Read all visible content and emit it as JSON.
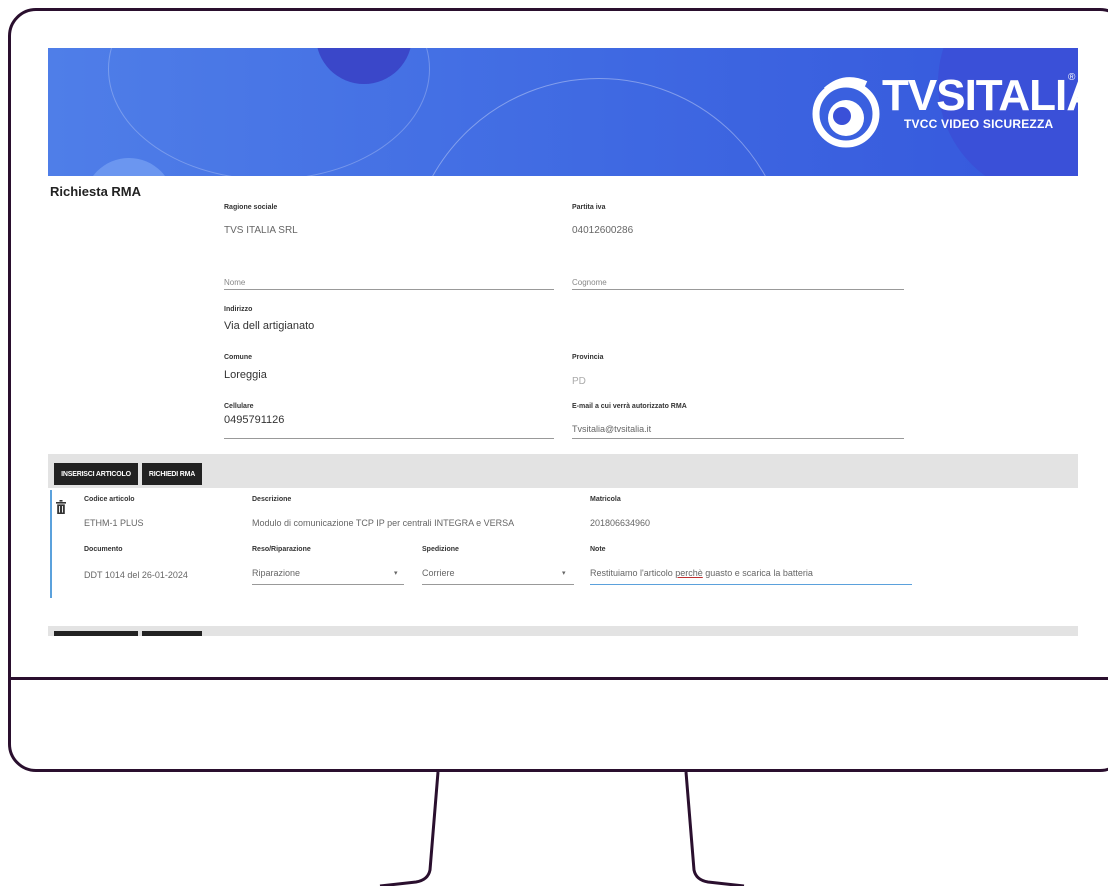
{
  "brand": {
    "name": "TVSITALIA",
    "registered": "®",
    "tagline": "TVCC VIDEO SICUREZZA"
  },
  "page_title": "Richiesta RMA",
  "form": {
    "ragione_sociale": {
      "label": "Ragione sociale",
      "value": "TVS ITALIA SRL"
    },
    "partita_iva": {
      "label": "Partita iva",
      "value": "04012600286"
    },
    "nome": {
      "placeholder": "Nome"
    },
    "cognome": {
      "placeholder": "Cognome"
    },
    "indirizzo": {
      "label": "Indirizzo",
      "value": "Via dell artigianato"
    },
    "comune": {
      "label": "Comune",
      "value": "Loreggia"
    },
    "provincia": {
      "label": "Provincia",
      "value": "PD"
    },
    "cellulare": {
      "label": "Cellulare",
      "value": "0495791126"
    },
    "email": {
      "label": "E-mail a cui verrà autorizzato RMA",
      "value": "Tvsitalia@tvsitalia.it"
    }
  },
  "toolbar": {
    "insert_label": "INSERISCI ARTICOLO",
    "request_label": "RICHIEDI RMA"
  },
  "article": {
    "codice": {
      "label": "Codice articolo",
      "value": "ETHM-1 PLUS"
    },
    "descrizione": {
      "label": "Descrizione",
      "value": "Modulo di comunicazione TCP IP per centrali INTEGRA e VERSA"
    },
    "matricola": {
      "label": "Matricola",
      "value": "201806634960"
    },
    "documento": {
      "label": "Documento",
      "value": "DDT 1014 del 26-01-2024"
    },
    "reso": {
      "label": "Reso/Riparazione",
      "value": "Riparazione"
    },
    "spedizione": {
      "label": "Spedizione",
      "value": "Corriere"
    },
    "note": {
      "label": "Note",
      "value_pre": "Restituiamo l'articolo ",
      "value_underlined": "perchè",
      "value_post": " guasto e scarica la batteria"
    }
  },
  "icons": {
    "trash": "trash-icon",
    "dropdown": "chevron-down-icon",
    "logo": "tvs-eye-logo-icon"
  },
  "colors": {
    "banner": "#3f69e2",
    "accent": "#5ba1dc",
    "button": "#222222",
    "frame": "#2a0f2e"
  }
}
